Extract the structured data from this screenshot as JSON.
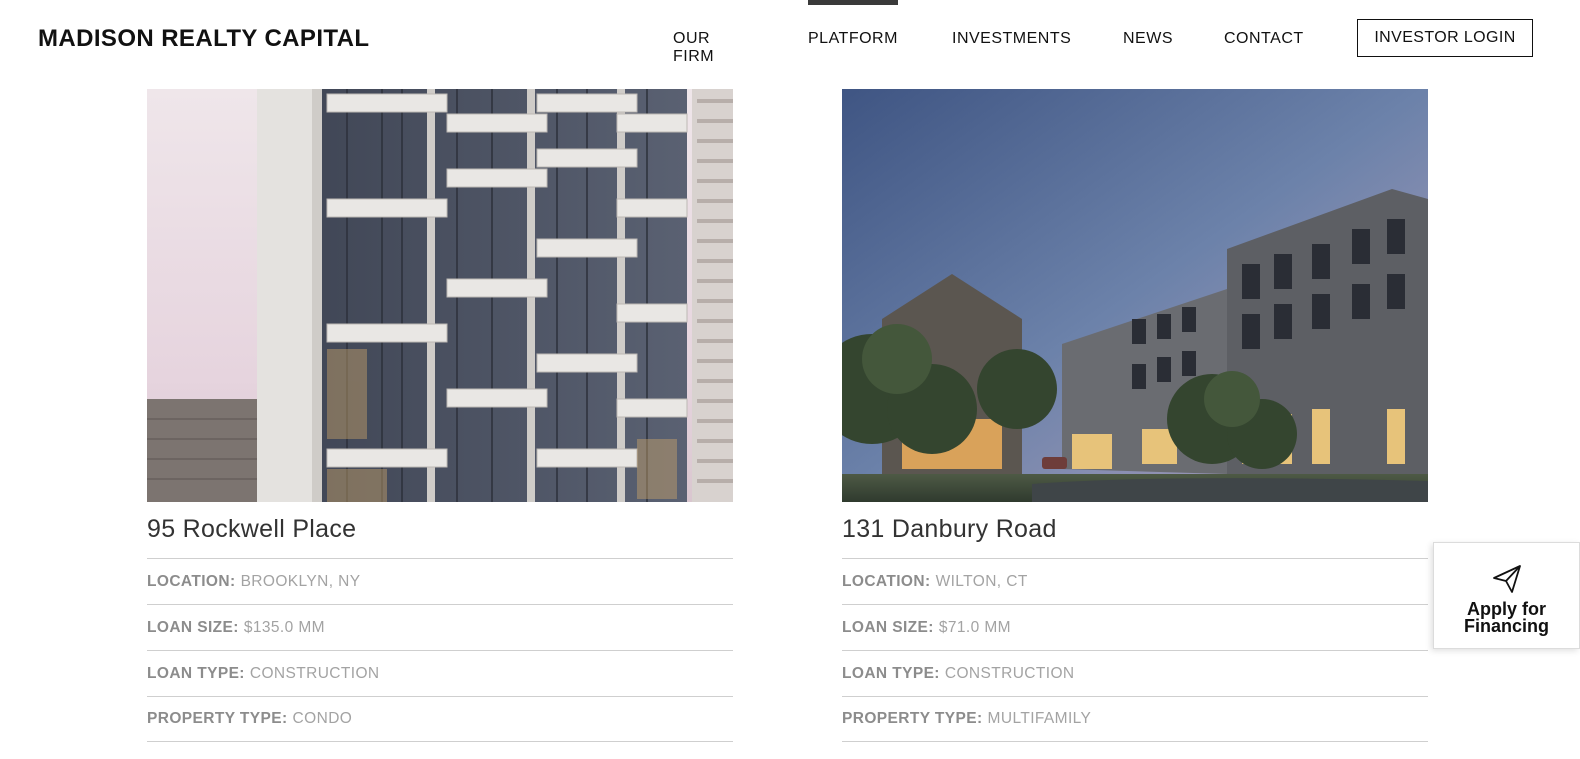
{
  "brand": {
    "name": "MADISON REALTY CAPITAL"
  },
  "nav": {
    "items": [
      {
        "label": "OUR FIRM"
      },
      {
        "label": "PLATFORM"
      },
      {
        "label": "INVESTMENTS"
      },
      {
        "label": "NEWS"
      },
      {
        "label": "CONTACT"
      }
    ],
    "active": "PLATFORM",
    "login_label": "INVESTOR LOGIN"
  },
  "investments": [
    {
      "title": "95 Rockwell Place",
      "details": [
        {
          "label": "LOCATION:",
          "value": "BROOKLYN, NY"
        },
        {
          "label": "LOAN SIZE:",
          "value": "$135.0 MM"
        },
        {
          "label": "LOAN TYPE:",
          "value": "CONSTRUCTION"
        },
        {
          "label": "PROPERTY TYPE:",
          "value": "CONDO"
        }
      ]
    },
    {
      "title": "131 Danbury Road",
      "details": [
        {
          "label": "LOCATION:",
          "value": "WILTON, CT"
        },
        {
          "label": "LOAN SIZE:",
          "value": "$71.0 MM"
        },
        {
          "label": "LOAN TYPE:",
          "value": "CONSTRUCTION"
        },
        {
          "label": "PROPERTY TYPE:",
          "value": "MULTIFAMILY"
        }
      ]
    }
  ],
  "apply": {
    "label_line1": "Apply for",
    "label_line2": "Financing",
    "icon": "paper-plane-icon"
  }
}
